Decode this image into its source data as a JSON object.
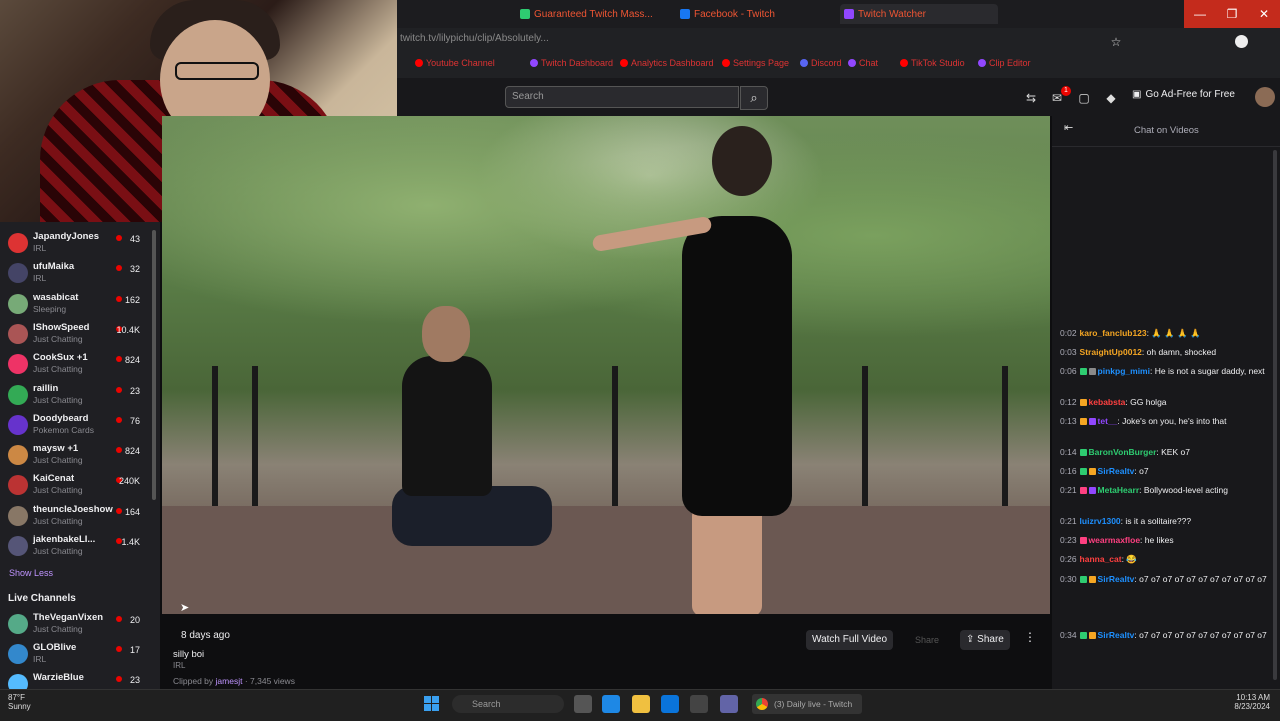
{
  "browser": {
    "tabs": [
      {
        "label": "Guaranteed Twitch Mass...",
        "color": "#2ecc71"
      },
      {
        "label": "Facebook - Twitch",
        "color": "#1877f2"
      },
      {
        "label": "Twitch Watcher",
        "color": "#9147ff"
      }
    ],
    "url": "twitch.tv/lilypichu/clip/Absolutely...",
    "bookmarks": [
      {
        "label": "Youtube Channel",
        "color": "#ff0000"
      },
      {
        "label": "Twitch Dashboard",
        "color": "#9147ff"
      },
      {
        "label": "Analytics Dashboard",
        "color": "#ff0000"
      },
      {
        "label": "Settings Page",
        "color": "#ff0000"
      },
      {
        "label": "Discord",
        "color": "#5865f2"
      },
      {
        "label": "Chat",
        "color": "#9147ff"
      },
      {
        "label": "TikTok Studio",
        "color": "#ff0000"
      },
      {
        "label": "Clip Editor",
        "color": "#9147ff"
      }
    ],
    "window_controls": [
      "—",
      "❐",
      "✕"
    ]
  },
  "header": {
    "search_placeholder": "Search",
    "ad_free_label": "Go Ad-Free for Free",
    "notification_count": "1"
  },
  "sidebar": {
    "channels": [
      {
        "name": "JapandyJones",
        "sub": "IRL",
        "viewers": "43",
        "color": "#d33"
      },
      {
        "name": "ufuMaika",
        "sub": "IRL",
        "viewers": "32",
        "color": "#446"
      },
      {
        "name": "wasabicat",
        "sub": "Sleeping",
        "viewers": "162",
        "color": "#7a7"
      },
      {
        "name": "IShowSpeed",
        "sub": "Just Chatting",
        "viewers": "10.4K",
        "color": "#a55"
      },
      {
        "name": "CookSux +1",
        "sub": "Just Chatting",
        "viewers": "824",
        "color": "#e36"
      },
      {
        "name": "raillin",
        "sub": "Just Chatting",
        "viewers": "23",
        "color": "#3a5"
      },
      {
        "name": "Doodybeard",
        "sub": "Pokemon Cards",
        "viewers": "76",
        "color": "#63c"
      },
      {
        "name": "maysw +1",
        "sub": "Just Chatting",
        "viewers": "824",
        "color": "#c84"
      },
      {
        "name": "KaiCenat",
        "sub": "Just Chatting",
        "viewers": "240K",
        "color": "#b33"
      },
      {
        "name": "theuncleJoeshow",
        "sub": "Just Chatting",
        "viewers": "164",
        "color": "#876"
      },
      {
        "name": "jakenbakeLI...",
        "sub": "Just Chatting",
        "viewers": "1.4K",
        "color": "#557"
      }
    ],
    "show_less": "Show Less",
    "live_channels_title": "Live Channels",
    "live_channels": [
      {
        "name": "TheVeganVixen",
        "sub": "Just Chatting",
        "viewers": "20",
        "color": "#5a8"
      },
      {
        "name": "GLOBlive",
        "sub": "IRL",
        "viewers": "17",
        "color": "#38c"
      },
      {
        "name": "WarzieBlue",
        "sub": "",
        "viewers": "23",
        "color": "#5bf"
      }
    ]
  },
  "clip": {
    "age": "8 days ago",
    "title": "silly boi",
    "category": "IRL",
    "clipped_by_prefix": "Clipped by",
    "clipper": "jamesjt",
    "views": "· 7,345 views",
    "watch_full": "Watch Full Video",
    "greyed_action": "Share",
    "share": "Share",
    "more": "⋮"
  },
  "chat": {
    "title": "Chat on Videos",
    "messages": [
      {
        "time": "0:02",
        "user": "karo_fanclub123",
        "color": "#f5a623",
        "badges": [],
        "text": "🙏 🙏 🙏 🙏"
      },
      {
        "time": "0:03",
        "user": "StraightUp0012",
        "color": "#f5a623",
        "badges": [],
        "text": "oh damn, shocked"
      },
      {
        "time": "0:06",
        "user": "pinkpg_mimi",
        "color": "#1e90ff",
        "badges": [
          "#2ecc71",
          "#8a8a8a"
        ],
        "text": "He is not a sugar daddy, next"
      },
      {
        "time": "0:12",
        "user": "kebabsta",
        "color": "#ff4040",
        "badges": [
          "#f5a623"
        ],
        "text": "GG holga"
      },
      {
        "time": "0:13",
        "user": "tet__",
        "color": "#9147ff",
        "badges": [
          "#f5a623",
          "#9147ff"
        ],
        "text": "Joke's on you, he's into that"
      },
      {
        "time": "0:14",
        "user": "BaronVonBurger",
        "color": "#2ecc71",
        "badges": [
          "#2ecc71"
        ],
        "text": "KEK o7"
      },
      {
        "time": "0:16",
        "user": "SirRealtv",
        "color": "#1e90ff",
        "badges": [
          "#2ecc71",
          "#f5a623"
        ],
        "text": "o7"
      },
      {
        "time": "0:21",
        "user": "MetaHearr",
        "color": "#2ecc71",
        "badges": [
          "#ff4081",
          "#9147ff"
        ],
        "text": "Bollywood-level acting"
      },
      {
        "time": "0:21",
        "user": "luizrv1300",
        "color": "#1e90ff",
        "badges": [],
        "text": "is it a solitaire???"
      },
      {
        "time": "0:23",
        "user": "wearmaxfloe",
        "color": "#ff4081",
        "badges": [
          "#ff4081"
        ],
        "text": "he likes"
      },
      {
        "time": "0:26",
        "user": "hanna_cat",
        "color": "#ff4040",
        "badges": [],
        "text": "😂"
      },
      {
        "time": "0:30",
        "user": "SirRealtv",
        "color": "#1e90ff",
        "badges": [
          "#2ecc71",
          "#f5a623"
        ],
        "text": "o7 o7 o7 o7 o7 o7 o7 o7 o7 o7 o7"
      },
      {
        "time": "0:34",
        "user": "SirRealtv",
        "color": "#1e90ff",
        "badges": [
          "#2ecc71",
          "#f5a623"
        ],
        "text": "o7 o7 o7 o7 o7 o7 o7 o7 o7 o7 o7"
      }
    ]
  },
  "taskbar": {
    "weather": "87°F",
    "weather_sub": "Sunny",
    "search": "Search",
    "chrome_title": "(3) Daily live - Twitch",
    "time": "10:13 AM",
    "date": "8/23/2024"
  }
}
